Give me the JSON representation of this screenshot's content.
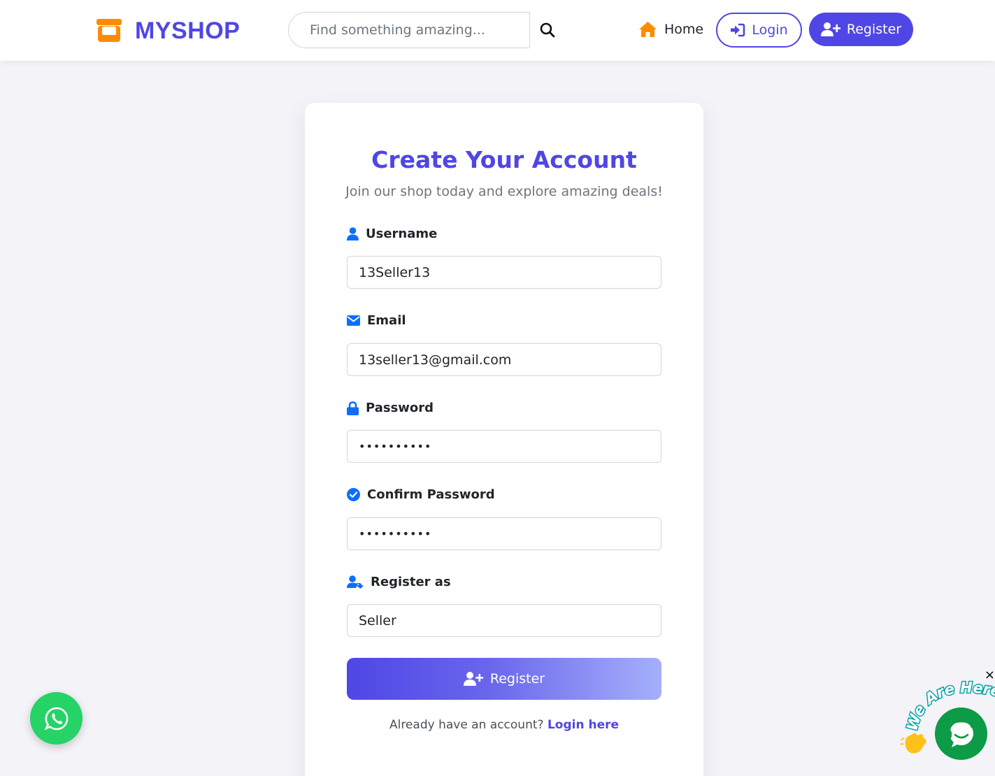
{
  "brand": {
    "name": "MYSHOP"
  },
  "search": {
    "placeholder": "Find something amazing..."
  },
  "nav": {
    "home": "Home",
    "login": "Login",
    "register": "Register"
  },
  "form": {
    "title": "Create Your Account",
    "subtitle": "Join our shop today and explore amazing deals!",
    "fields": [
      {
        "label": "Username",
        "value": "13Seller13",
        "icon": "user-icon"
      },
      {
        "label": "Email",
        "value": "13seller13@gmail.com",
        "icon": "envelope-icon"
      },
      {
        "label": "Password",
        "value": "••••••••••",
        "icon": "lock-icon"
      },
      {
        "label": "Confirm Password",
        "value": "••••••••••",
        "icon": "check-circle-icon"
      },
      {
        "label": "Register as",
        "value": "Seller",
        "icon": "user-tag-icon"
      }
    ],
    "submit": "Register",
    "footer_text": "Already have an account?",
    "footer_link": "Login here"
  },
  "chat_widget": {
    "close": "×",
    "banner": "We Are Here"
  },
  "colors": {
    "primary": "#4f46e5",
    "accent": "#ff8c00",
    "icon_blue": "#0d6efd",
    "whatsapp": "#25d366",
    "chat": "#0c9b47"
  }
}
